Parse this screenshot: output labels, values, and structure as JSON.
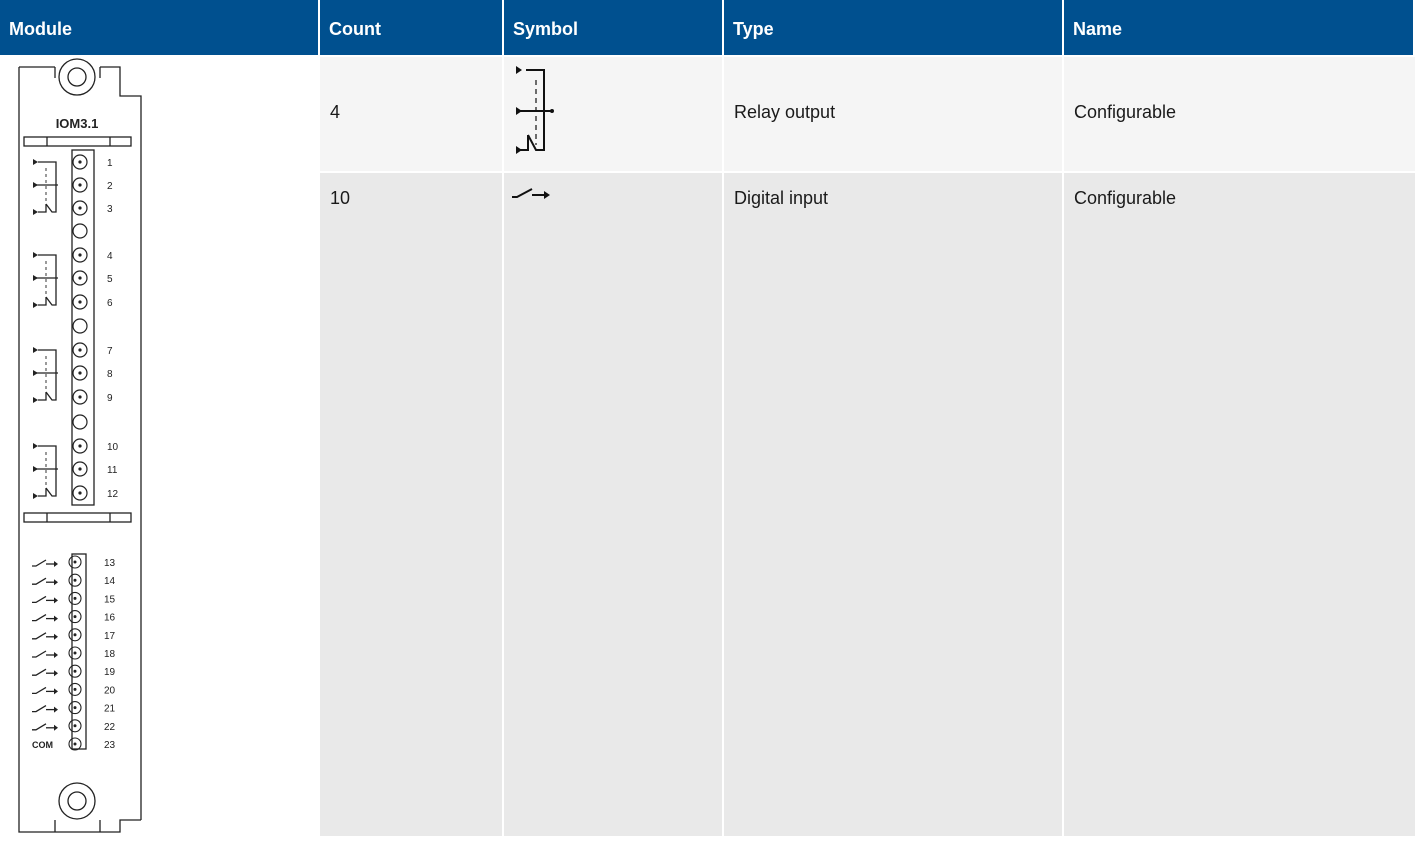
{
  "headers": {
    "module": "Module",
    "count": "Count",
    "symbol": "Symbol",
    "type": "Type",
    "name": "Name"
  },
  "module": {
    "title": "IOM3.1",
    "relay_terminals": [
      "1",
      "2",
      "3",
      "4",
      "5",
      "6",
      "7",
      "8",
      "9",
      "10",
      "11",
      "12"
    ],
    "input_terminals": [
      "13",
      "14",
      "15",
      "16",
      "17",
      "18",
      "19",
      "20",
      "21",
      "22",
      "23"
    ],
    "com_label": "COM"
  },
  "rows": [
    {
      "count": "4",
      "symbol": "relay-output-symbol-icon",
      "type": "Relay output",
      "name": "Configurable"
    },
    {
      "count": "10",
      "symbol": "digital-input-symbol-icon",
      "type": "Digital input",
      "name": "Configurable"
    }
  ],
  "colors": {
    "header_bg": "#00508f",
    "row1_bg": "#f5f5f5",
    "row2_bg": "#e9e9e9"
  }
}
